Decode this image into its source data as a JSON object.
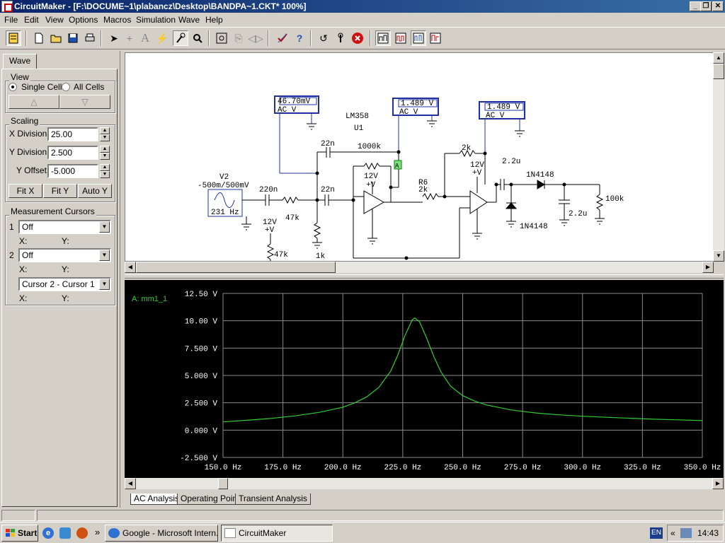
{
  "window": {
    "title": "CircuitMaker - [F:\\DOCUME~1\\plabancz\\Desktop\\BANDPA~1.CKT* 100%]"
  },
  "menu": [
    "File",
    "Edit",
    "View",
    "Options",
    "Macros",
    "Simulation",
    "Wave",
    "Help"
  ],
  "left_panel": {
    "tab": "Wave",
    "view": {
      "label": "View",
      "single_cell": "Single Cell",
      "all_cells": "All Cells",
      "up": "△",
      "down": "▽"
    },
    "scaling": {
      "label": "Scaling",
      "x_division_label": "X Division",
      "x_division": "25.00",
      "y_division_label": "Y Division",
      "y_division": "2.500",
      "y_offset_label": "Y Offset",
      "y_offset": "-5.000",
      "fit_x": "Fit X",
      "fit_y": "Fit Y",
      "auto_y": "Auto Y"
    },
    "cursors": {
      "label": "Measurement Cursors",
      "c1_num": "1",
      "c1_value": "Off",
      "c1_x": "X:",
      "c1_y": "Y:",
      "c2_num": "2",
      "c2_value": "Off",
      "c2_x": "X:",
      "c2_y": "Y:",
      "diff_value": "Cursor 2 - Cursor 1",
      "diff_x": "X:",
      "diff_y": "Y:"
    }
  },
  "schematic": {
    "meter1_value": "46.70mV",
    "meter2_value": "1.489 V",
    "meter3_value": "1.489 V",
    "meter_mode": "AC  V",
    "lm358": "LM358",
    "u1": "U1",
    "source_name": "V2",
    "source_value": "-500m/500mV",
    "source_freq": "231 Hz",
    "c220n": "220n",
    "r47k_series": "47k",
    "c22n_top": "22n",
    "c22n_mid": "22n",
    "r1000k": "1000k",
    "r1k": "1k",
    "r47k_bias": "47k",
    "vcc_label": "12V",
    "vplus": "+V",
    "r6": "R6",
    "r2k_a": "2k",
    "r2k_b": "2k",
    "c2_2u_a": "2.2u",
    "c2_2u_b": "2.2u",
    "d1": "1N4148",
    "d2": "1N4148",
    "r100k": "100k",
    "probe": "A"
  },
  "wave": {
    "trace_label": "A: mm1_1",
    "trace_color": "#33cc33",
    "bottom_tabs": [
      "AC Analysis",
      "Operating Point",
      "Transient Analysis"
    ]
  },
  "chart_data": {
    "type": "line",
    "title": "",
    "xlabel": "",
    "ylabel": "",
    "xlim": [
      150,
      350
    ],
    "ylim": [
      -2.5,
      12.5
    ],
    "x_ticks": [
      "150.0 Hz",
      "175.0 Hz",
      "200.0 Hz",
      "225.0 Hz",
      "250.0 Hz",
      "275.0 Hz",
      "300.0 Hz",
      "325.0 Hz",
      "350.0 Hz"
    ],
    "y_ticks": [
      "12.50 V",
      "10.00 V",
      "7.500 V",
      "5.000 V",
      "2.500 V",
      "0.000 V",
      "-2.500 V"
    ],
    "grid": true,
    "series": [
      {
        "name": "A: mm1_1",
        "x": [
          150,
          160,
          170,
          180,
          190,
          200,
          205,
          210,
          215,
          220,
          223,
          226,
          229,
          230,
          232,
          235,
          238,
          241,
          245,
          250,
          255,
          260,
          270,
          280,
          290,
          300,
          310,
          320,
          330,
          340,
          350
        ],
        "y": [
          0.75,
          0.9,
          1.07,
          1.3,
          1.62,
          2.1,
          2.5,
          3.05,
          3.9,
          5.4,
          6.9,
          8.7,
          10.1,
          10.25,
          9.9,
          8.4,
          6.7,
          5.3,
          4.0,
          3.15,
          2.65,
          2.3,
          1.85,
          1.58,
          1.4,
          1.27,
          1.17,
          1.08,
          1.0,
          0.94,
          0.87
        ]
      }
    ]
  },
  "taskbar": {
    "start": "Start",
    "task1": "Google - Microsoft Intern...",
    "task2": "CircuitMaker",
    "lang": "EN",
    "time": "14:43"
  }
}
